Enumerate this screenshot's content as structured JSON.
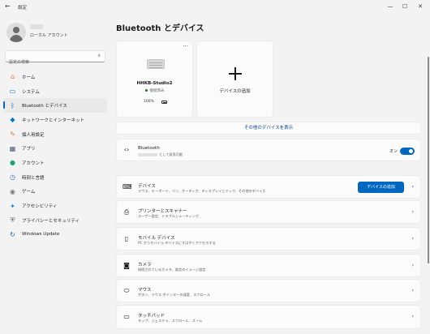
{
  "window": {
    "title": "設定",
    "back": "←",
    "minimize": "—",
    "maximize": "☐",
    "close": "✕"
  },
  "account": {
    "type": "ローカル アカウント"
  },
  "search": {
    "placeholder": "設定の検索",
    "icon": "search-icon"
  },
  "nav": [
    {
      "label": "ホーム",
      "icon": "home-icon",
      "color": "#e36f3d",
      "active": false
    },
    {
      "label": "システム",
      "icon": "monitor-icon",
      "color": "#0078d4",
      "active": false
    },
    {
      "label": "Bluetooth とデバイス",
      "icon": "bluetooth-icon",
      "color": "#0067c0",
      "active": true
    },
    {
      "label": "ネットワークとインターネット",
      "icon": "wifi-icon",
      "color": "#0078d4",
      "active": false
    },
    {
      "label": "個人用設定",
      "icon": "brush-icon",
      "color": "#d9812a",
      "active": false
    },
    {
      "label": "アプリ",
      "icon": "apps-icon",
      "color": "#4a5a72",
      "active": false
    },
    {
      "label": "アカウント",
      "icon": "person-icon",
      "color": "#1aa37a",
      "active": false
    },
    {
      "label": "時刻と言語",
      "icon": "globe-clock-icon",
      "color": "#2f6fd0",
      "active": false
    },
    {
      "label": "ゲーム",
      "icon": "gamepad-icon",
      "color": "#7a7a7a",
      "active": false
    },
    {
      "label": "アクセシビリティ",
      "icon": "accessibility-icon",
      "color": "#1f7fd8",
      "active": false
    },
    {
      "label": "プライバシーとセキュリティ",
      "icon": "shield-icon",
      "color": "#6b6b6b",
      "active": false
    },
    {
      "label": "Windows Update",
      "icon": "update-icon",
      "color": "#0067c0",
      "active": false
    }
  ],
  "page": {
    "title": "Bluetooth とデバイス"
  },
  "device_card": {
    "name": "HHKB-Studio2",
    "status": "接続済み",
    "battery": "100%",
    "more": "···"
  },
  "add_card": {
    "label": "デバイスの追加"
  },
  "show_more": "その他のデバイスを表示",
  "bluetooth_row": {
    "title": "Bluetooth",
    "subtitle": "として発見可能",
    "toggle_label": "オン",
    "toggle_on": true
  },
  "rows": [
    {
      "title": "デバイス",
      "subtitle": "マウス、キーボード、ペン、オーディオ、ディスプレイとドック、その他のデバイス",
      "icon": "devices-icon",
      "button": "デバイスの追加"
    },
    {
      "title": "プリンターとスキャナー",
      "subtitle": "ユーザー設定、トラブルシューティング",
      "icon": "printer-icon"
    },
    {
      "title": "モバイル デバイス",
      "subtitle": "PC からモバイル デバイスにすばやくアクセスする",
      "icon": "phone-icon"
    },
    {
      "title": "カメラ",
      "subtitle": "接続されているカメラ、既定のイメージ設定",
      "icon": "camera-icon"
    },
    {
      "title": "マウス",
      "subtitle": "ボタン、マウス ポインターの速度、スクロール",
      "icon": "mouse-icon"
    },
    {
      "title": "タッチパッド",
      "subtitle": "タップ、ジェスチャ、スクロール、ズーム",
      "icon": "touchpad-icon"
    }
  ]
}
